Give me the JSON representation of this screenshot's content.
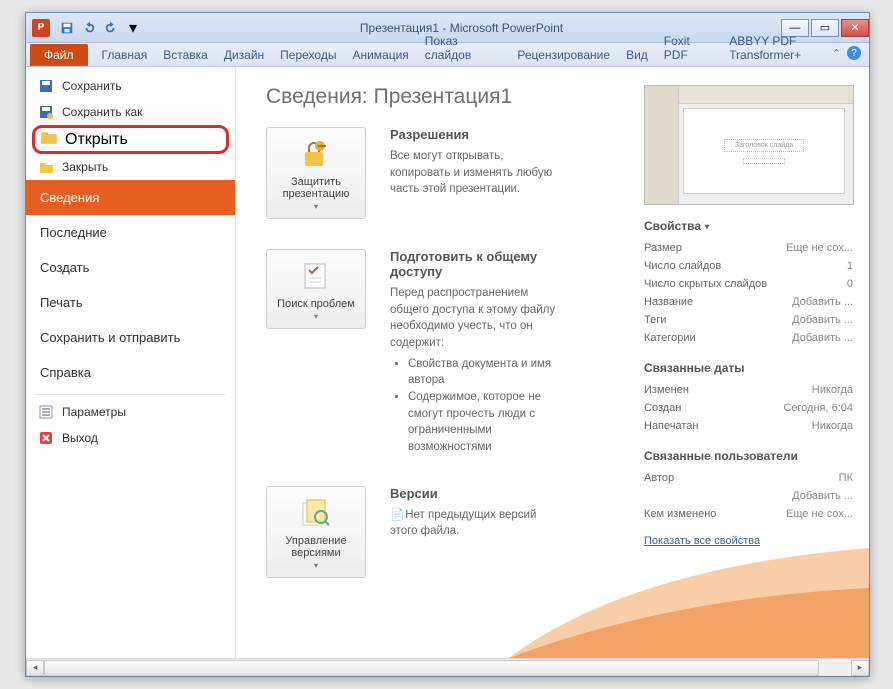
{
  "titlebar": {
    "doc": "Презентация1",
    "app": "Microsoft PowerPoint"
  },
  "tabs": {
    "file": "Файл",
    "items": [
      "Главная",
      "Вставка",
      "Дизайн",
      "Переходы",
      "Анимация",
      "Показ слайдов",
      "Рецензирование",
      "Вид",
      "Foxit PDF",
      "ABBYY PDF Transformer+"
    ]
  },
  "backstage_left": {
    "save": "Сохранить",
    "saveas": "Сохранить как",
    "open": "Открыть",
    "close": "Закрыть",
    "info": "Сведения",
    "recent": "Последние",
    "new": "Создать",
    "print": "Печать",
    "saveSend": "Сохранить и отправить",
    "help": "Справка",
    "options": "Параметры",
    "exit": "Выход"
  },
  "info": {
    "title_prefix": "Сведения: ",
    "title_doc": "Презентация1",
    "protect_btn": "Защитить презентацию",
    "permissions_h": "Разрешения",
    "permissions_t": "Все могут открывать, копировать и изменять любую часть этой презентации.",
    "check_btn": "Поиск проблем",
    "prepare_h": "Подготовить к общему доступу",
    "prepare_t": "Перед распространением общего доступа к этому файлу необходимо учесть, что он содержит:",
    "prepare_li1": "Свойства документа и имя автора",
    "prepare_li2": "Содержимое, которое не смогут прочесть люди с ограниченными возможностями",
    "versions_btn": "Управление версиями",
    "versions_h": "Версии",
    "versions_t": "Нет предыдущих версий этого файла."
  },
  "props": {
    "header": "Свойства",
    "rows": [
      {
        "k": "Размер",
        "v": "Еще не сох..."
      },
      {
        "k": "Число слайдов",
        "v": "1"
      },
      {
        "k": "Число скрытых слайдов",
        "v": "0"
      },
      {
        "k": "Название",
        "v": "Добавить ..."
      },
      {
        "k": "Теги",
        "v": "Добавить ..."
      },
      {
        "k": "Категории",
        "v": "Добавить ..."
      }
    ],
    "dates_h": "Связанные даты",
    "dates": [
      {
        "k": "Изменен",
        "v": "Никогда"
      },
      {
        "k": "Создан",
        "v": "Сегодня, 6:04"
      },
      {
        "k": "Напечатан",
        "v": "Никогда"
      }
    ],
    "people_h": "Связанные пользователи",
    "people": [
      {
        "k": "Автор",
        "v": "ПК"
      },
      {
        "k": "",
        "v": "Добавить ..."
      },
      {
        "k": "Кем изменено",
        "v": "Еще не сох..."
      }
    ],
    "show_all": "Показать все свойства"
  },
  "thumb": {
    "ph1": "Заголовок слайда",
    "ph2": ""
  }
}
